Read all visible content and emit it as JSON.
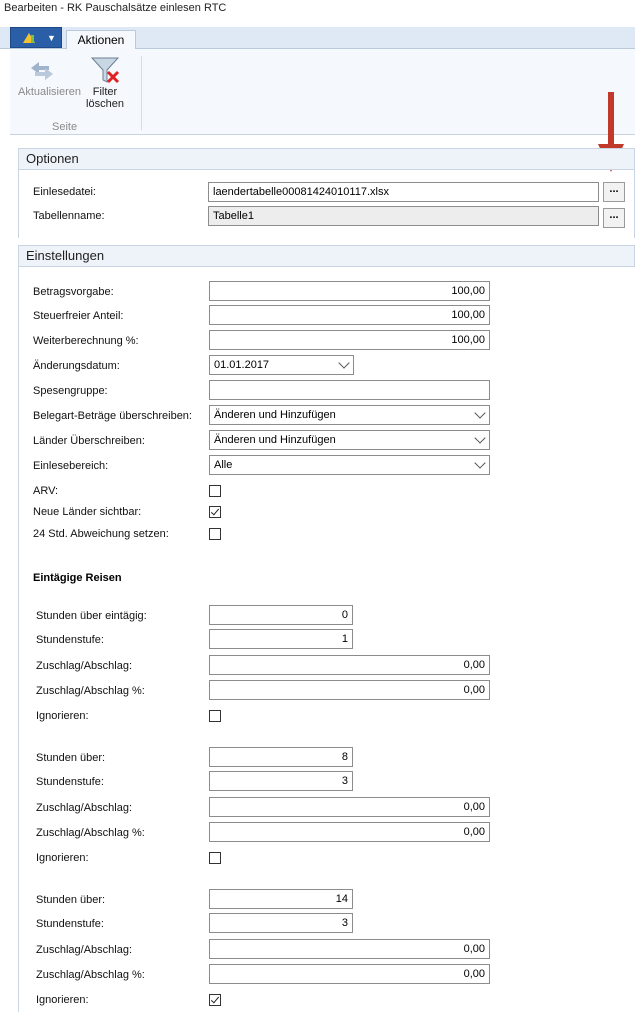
{
  "window": {
    "title": "Bearbeiten - RK Pauschalsätze einlesen RTC"
  },
  "ribbon": {
    "tab": "Aktionen",
    "actions": [
      {
        "label": "Aktualisieren",
        "icon": "refresh-icon",
        "enabled": false
      },
      {
        "label": "Filter",
        "label2": "löschen",
        "icon": "clear-filter-icon",
        "enabled": true
      }
    ],
    "group_label": "Seite"
  },
  "optionen": {
    "title": "Optionen",
    "einlesedatei": {
      "label": "Einlesedatei:",
      "value": "laendertabelle00081424010117.xlsx",
      "button": "..."
    },
    "tabellenname": {
      "label": "Tabellenname:",
      "value": "Tabelle1",
      "button": "..."
    }
  },
  "einstellungen": {
    "title": "Einstellungen",
    "betragsvorgabe": {
      "label": "Betragsvorgabe:",
      "value": "100,00"
    },
    "steuerfreier_anteil": {
      "label": "Steuerfreier Anteil:",
      "value": "100,00"
    },
    "weiterberechnung": {
      "label": "Weiterberechnung %:",
      "value": "100,00"
    },
    "aenderungsdatum": {
      "label": "Änderungsdatum:",
      "value": "01.01.2017"
    },
    "spesengruppe": {
      "label": "Spesengruppe:",
      "value": ""
    },
    "belegart": {
      "label": "Belegart-Beträge überschreiben:",
      "value": "Änderen und Hinzufügen"
    },
    "laender_ueberschreiben": {
      "label": "Länder Überschreiben:",
      "value": "Änderen und Hinzufügen"
    },
    "einlesebereich": {
      "label": "Einlesebereich:",
      "value": "Alle"
    },
    "arv": {
      "label": "ARV:",
      "checked": false
    },
    "neue_laender": {
      "label": "Neue Länder sichtbar:",
      "checked": true
    },
    "abweichung": {
      "label": "24 Std. Abweichung setzen:",
      "checked": false
    },
    "eintaegige_reisen": "Eintägige Reisen",
    "groups": [
      {
        "stunden_label": "Stunden über eintägig:",
        "stunden": "0",
        "stufe_label": "Stundenstufe:",
        "stufe": "1",
        "zuschlag_label": "Zuschlag/Abschlag:",
        "zuschlag": "0,00",
        "zuschlag_pct_label": "Zuschlag/Abschlag %:",
        "zuschlag_pct": "0,00",
        "ignorieren_label": "Ignorieren:",
        "ignorieren": false
      },
      {
        "stunden_label": "Stunden über:",
        "stunden": "8",
        "stufe_label": "Stundenstufe:",
        "stufe": "3",
        "zuschlag_label": "Zuschlag/Abschlag:",
        "zuschlag": "0,00",
        "zuschlag_pct_label": "Zuschlag/Abschlag %:",
        "zuschlag_pct": "0,00",
        "ignorieren_label": "Ignorieren:",
        "ignorieren": false
      },
      {
        "stunden_label": "Stunden über:",
        "stunden": "14",
        "stufe_label": "Stundenstufe:",
        "stufe": "3",
        "zuschlag_label": "Zuschlag/Abschlag:",
        "zuschlag": "0,00",
        "zuschlag_pct_label": "Zuschlag/Abschlag %:",
        "zuschlag_pct": "0,00",
        "ignorieren_label": "Ignorieren:",
        "ignorieren": true
      }
    ]
  },
  "colors": {
    "annotation_arrow": "#c0392b",
    "section_header_bg": "#eef3f9"
  }
}
